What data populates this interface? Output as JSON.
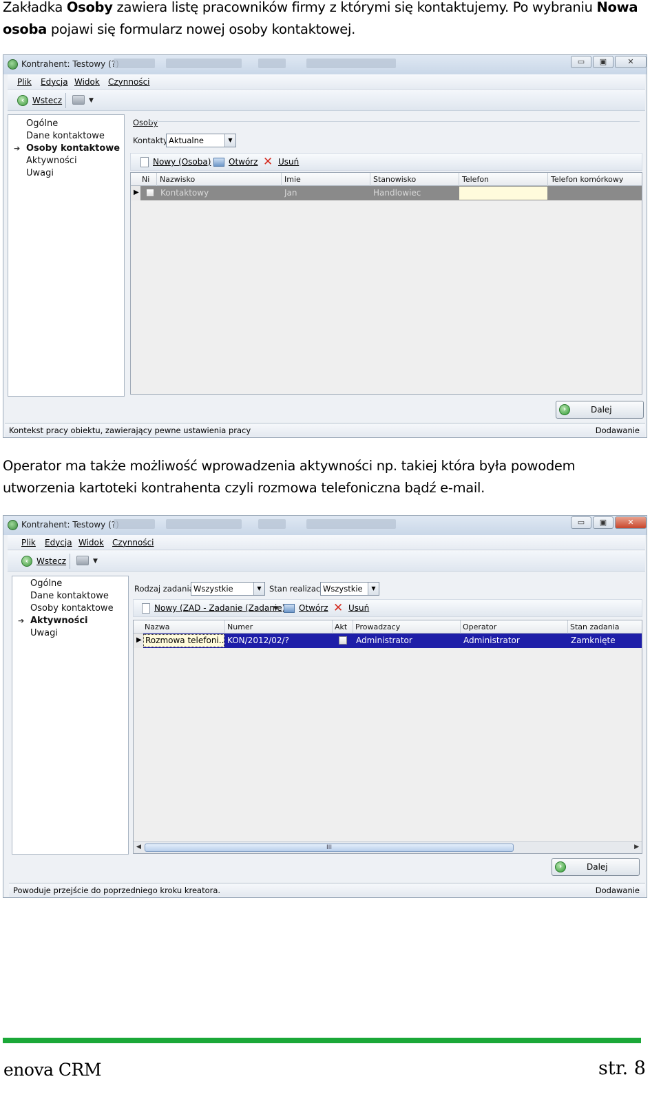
{
  "paragraph1": {
    "t1": "Zakładka ",
    "b1": "Osoby",
    "t2": " zawiera listę pracowników firmy z którymi się kontaktujemy. Po wybraniu ",
    "b2": "Nowa osoba",
    "t3": "  pojawi się formularz nowej osoby kontaktowej."
  },
  "paragraph2": "Operator ma także możliwość wprowadzenia aktywności np. takiej która była powodem utworzenia kartoteki kontrahenta czyli rozmowa telefoniczna bądź e-mail.",
  "window1": {
    "title": "Kontrahent: Testowy (?)",
    "menu": [
      "Plik",
      "Edycja",
      "Widok",
      "Czynności"
    ],
    "back_label": "Wstecz",
    "nav": [
      "Ogólne",
      "Dane kontaktowe",
      "Osoby kontaktowe",
      "Aktywności",
      "Uwagi"
    ],
    "active_nav": "Osoby kontaktowe",
    "group_label": "Osoby",
    "filter_label": "Kontakty:",
    "filter_value": "Aktualne",
    "toolbar": {
      "new": "Nowy (Osoba)",
      "open": "Otwórz",
      "delete": "Usuń"
    },
    "columns": [
      "Ni",
      "Nazwisko",
      "Imie",
      "Stanowisko",
      "Telefon",
      "Telefon komórkowy"
    ],
    "row": {
      "nazwisko": "Kontaktowy",
      "imie": "Jan",
      "stanowisko": "Handlowiec",
      "telefon": "",
      "komorkowy": ""
    },
    "next_label": "Dalej",
    "status_left": "Kontekst pracy obiektu, zawierający pewne ustawienia pracy",
    "status_right": "Dodawanie"
  },
  "window2": {
    "title": "Kontrahent: Testowy (?)",
    "menu": [
      "Plik",
      "Edycja",
      "Widok",
      "Czynności"
    ],
    "back_label": "Wstecz",
    "nav": [
      "Ogólne",
      "Dane kontaktowe",
      "Osoby kontaktowe",
      "Aktywności",
      "Uwagi"
    ],
    "active_nav": "Aktywności",
    "filter1_label": "Rodzaj zadania:",
    "filter1_value": "Wszystkie",
    "filter2_label": "Stan realizacji:",
    "filter2_value": "Wszystkie",
    "toolbar": {
      "new": "Nowy (ZAD - Zadanie (Zadanie))",
      "open": "Otwórz",
      "delete": "Usuń"
    },
    "columns": [
      "Nazwa",
      "Numer",
      "Akt",
      "Prowadzacy",
      "Operator",
      "Stan zadania"
    ],
    "row": {
      "nazwa": "Rozmowa telefoni...",
      "numer": "KON/2012/02/?",
      "prowadzacy": "Administrator",
      "operator": "Administrator",
      "stan": "Zamknięte"
    },
    "scroll_grip": "III",
    "next_label": "Dalej",
    "status_left": "Powoduje przejście do poprzedniego kroku kreatora.",
    "status_right": "Dodawanie"
  },
  "footer": {
    "left": "enova CRM",
    "right": "str. 8"
  },
  "colors": {
    "selection": "#1e1ea8",
    "inactive_row": "#8a8a8a",
    "accent_line": "#1ba838"
  }
}
